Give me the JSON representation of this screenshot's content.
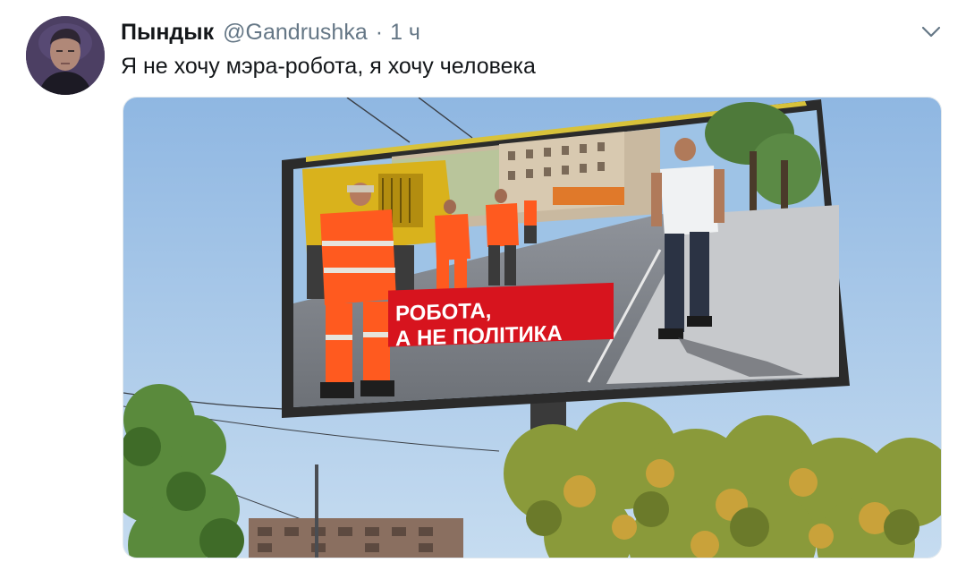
{
  "tweet": {
    "display_name": "Пындык",
    "handle": "@Gandrushka",
    "separator": "·",
    "time": "1 ч",
    "text": "Я не хочу мэра-робота, я хочу человека",
    "caret_icon": "chevron-down-icon"
  },
  "media": {
    "billboard_text_line1": "РОБОТА,",
    "billboard_text_line2": "А НЕ ПОЛІТИКА",
    "billboard_accent": "#d7141e",
    "billboard_frame": "#2b2b2b",
    "billboard_top_edge": "#d8c23a",
    "sky": "#a9c8e8"
  }
}
